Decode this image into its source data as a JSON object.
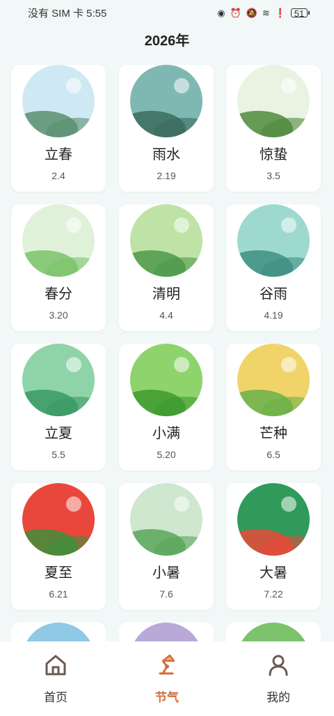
{
  "status": {
    "carrier_time": "没有 SIM 卡 5:55",
    "icons": [
      "eye-icon",
      "alarm-icon",
      "mute-icon",
      "wifi-icon",
      "alert-icon",
      "battery-icon"
    ],
    "battery": "51"
  },
  "page": {
    "title": "2026年"
  },
  "terms": [
    {
      "name": "立春",
      "date": "2.4",
      "bg": "#cfe9f4",
      "fg": "#5a8f6f"
    },
    {
      "name": "雨水",
      "date": "2.19",
      "bg": "#7fb8b3",
      "fg": "#3c6b5e"
    },
    {
      "name": "惊蛰",
      "date": "3.5",
      "bg": "#e8f3e2",
      "fg": "#4f8a3c"
    },
    {
      "name": "春分",
      "date": "3.20",
      "bg": "#dff2d9",
      "fg": "#7cc36b"
    },
    {
      "name": "清明",
      "date": "4.4",
      "bg": "#bfe3a6",
      "fg": "#4d9a4a"
    },
    {
      "name": "谷雨",
      "date": "4.19",
      "bg": "#9ed9cf",
      "fg": "#3e8f82"
    },
    {
      "name": "立夏",
      "date": "5.5",
      "bg": "#8fd4a8",
      "fg": "#3a9a64"
    },
    {
      "name": "小满",
      "date": "5.20",
      "bg": "#8fd36d",
      "fg": "#3f9a2e"
    },
    {
      "name": "芒种",
      "date": "6.5",
      "bg": "#f0d46a",
      "fg": "#6ab04a"
    },
    {
      "name": "夏至",
      "date": "6.21",
      "bg": "#e9473c",
      "fg": "#3f8f3a"
    },
    {
      "name": "小暑",
      "date": "7.6",
      "bg": "#cfe6cf",
      "fg": "#5aa65a"
    },
    {
      "name": "大暑",
      "date": "7.22",
      "bg": "#2f9a5a",
      "fg": "#e84a3a"
    }
  ],
  "partial_thumbs": [
    "#8fc9e6",
    "#b9a9d9",
    "#7cc36b"
  ],
  "nav": {
    "home": "首页",
    "solar_terms": "节气",
    "mine": "我的"
  },
  "colors": {
    "accent": "#d26d3f",
    "icon": "#6b5a4e"
  }
}
